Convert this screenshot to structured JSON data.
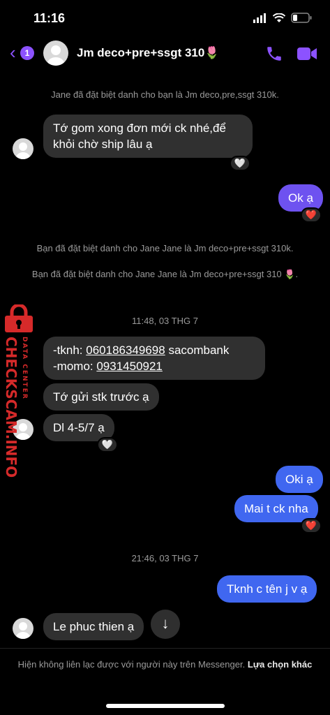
{
  "status": {
    "time": "11:16"
  },
  "header": {
    "back_badge": "1",
    "title": "Jm deco+pre+ssgt 310🌷"
  },
  "messages": {
    "info1": "Jane đã đặt biệt danh cho bạn là Jm deco,pre,ssgt 310k.",
    "in1": "Tớ gom xong đơn mới ck nhé,để khỏi chờ ship lâu ạ",
    "in1_react": "🤍",
    "out1": "Ok ạ",
    "out1_react": "❤️",
    "info2": "Bạn đã đặt biệt danh cho Jane Jane là Jm deco+pre+ssgt 310k.",
    "info3": "Bạn đã đặt biệt danh cho Jane Jane là Jm deco+pre+ssgt 310 🌷.",
    "time1": "11:48, 03 THG 7",
    "bank_line1_prefix": "-tknh: ",
    "bank_account": "060186349698",
    "bank_line1_suffix": " sacombank",
    "bank_line2_prefix": "-momo: ",
    "momo_number": "0931450921",
    "in3": "Tớ gửi stk trước ạ",
    "in4": "Dl 4-5/7 ạ",
    "in4_react": "🤍",
    "out2": "Oki ạ",
    "out3": "Mai t ck nha",
    "out3_react": "❤️",
    "time2": "21:46, 03 THG 7",
    "out4": "Tknh c tên j v ạ",
    "in5": "Le phuc thien ạ"
  },
  "footer": {
    "text": "Hiện không liên lạc được với người này trên Messenger.",
    "link": "Lựa chọn khác"
  },
  "watermark": {
    "brand": "CHECKSCAM.INFO",
    "sub": "DATA CENTER"
  },
  "colors": {
    "accent": "#8c52ff",
    "outgoing": "#6e52f0",
    "outgoing_alt": "#4067f0",
    "incoming": "#303030"
  }
}
